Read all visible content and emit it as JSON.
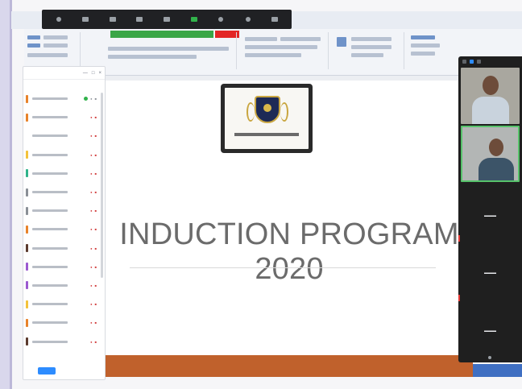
{
  "slide": {
    "title": "INDUCTION PROGRAM 2020"
  },
  "colors": {
    "slide_band": "#c0612c",
    "participants_panel": "#ffffff",
    "video_panel": "#1f1f1f",
    "active_speaker_border": "#57c26a",
    "ribbon_green": "#3aa647",
    "ribbon_red": "#e32626"
  },
  "zoom_bar": {
    "buttons": [
      {
        "icon": "mute-icon"
      },
      {
        "icon": "video-icon"
      },
      {
        "icon": "security-icon"
      },
      {
        "icon": "participants-icon"
      },
      {
        "icon": "chat-icon"
      },
      {
        "icon": "share-screen-icon"
      },
      {
        "icon": "record-icon"
      },
      {
        "icon": "reactions-icon"
      },
      {
        "icon": "more-icon"
      }
    ]
  },
  "participants": {
    "items": [
      {
        "color": "#e8822a",
        "mic": "on"
      },
      {
        "color": "#e8822a",
        "mic": "muted"
      },
      {
        "color": "#ffffff",
        "mic": "muted"
      },
      {
        "color": "#f3c23a",
        "mic": "muted"
      },
      {
        "color": "#2fb38a",
        "mic": "muted"
      },
      {
        "color": "#8a8f96",
        "mic": "muted"
      },
      {
        "color": "#8a8f96",
        "mic": "muted"
      },
      {
        "color": "#e8822a",
        "mic": "muted"
      },
      {
        "color": "#5b3a2e",
        "mic": "muted"
      },
      {
        "color": "#9b59d0",
        "mic": "muted"
      },
      {
        "color": "#9b59d0",
        "mic": "muted"
      },
      {
        "color": "#f3c23a",
        "mic": "muted"
      },
      {
        "color": "#e8822a",
        "mic": "muted"
      },
      {
        "color": "#5b3a2e",
        "mic": "muted"
      }
    ]
  },
  "video_panel": {
    "tiles": [
      {
        "kind": "camera"
      },
      {
        "kind": "camera",
        "active_speaker": true
      },
      {
        "kind": "name-only"
      },
      {
        "kind": "name-only"
      },
      {
        "kind": "name-only"
      }
    ]
  }
}
